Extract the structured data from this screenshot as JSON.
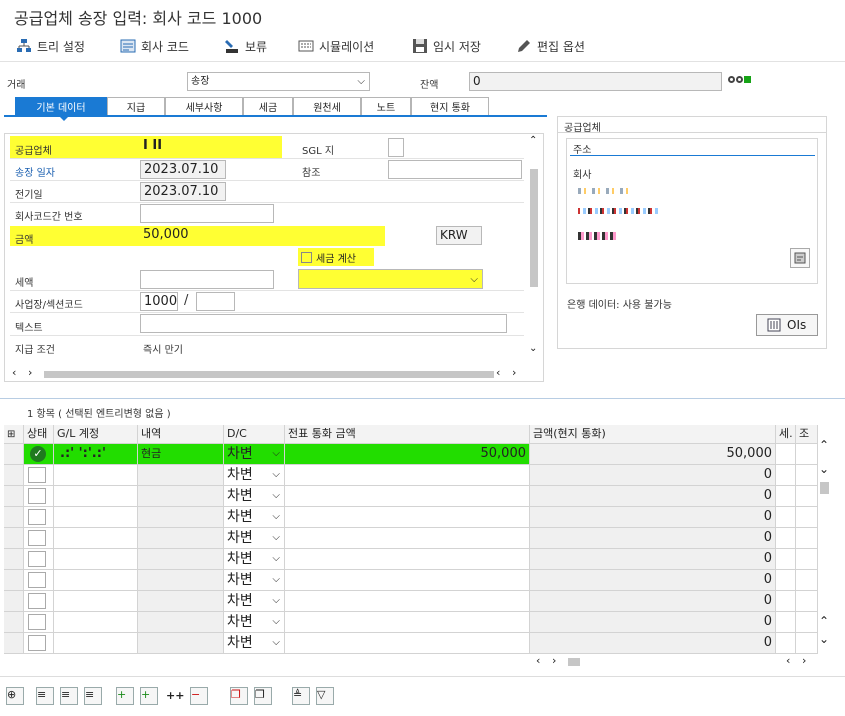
{
  "title": "공급업체 송장 입력: 회사 코드 1000",
  "toolbar": {
    "tree": "트리 설정",
    "company_code": "회사 코드",
    "hold": "보류",
    "simulate": "시뮬레이션",
    "park": "임시 저장",
    "edit_options": "편집 옵션"
  },
  "header": {
    "transaction_label": "거래",
    "transaction_value": "송장",
    "balance_label": "잔액",
    "balance_value": "0"
  },
  "tabs": [
    "기본 데이터",
    "지급",
    "세부사항",
    "세금",
    "원천세",
    "노트",
    "현지 통화"
  ],
  "basic": {
    "vendor_label": "공급업체",
    "vendor_value": "I  II",
    "sgl_label": "SGL 지",
    "invoice_date_label": "송장 일자",
    "invoice_date_value": "2023.07.10",
    "reference_label": "참조",
    "posting_date_label": "전기일",
    "posting_date_value": "2023.07.10",
    "cross_cc_label": "회사코드간 번호",
    "amount_label": "금액",
    "amount_value": "50,000",
    "currency": "KRW",
    "calc_tax_label": "세금 계산",
    "tax_label": "세액",
    "business_place_label": "사업장/섹션코드",
    "business_place_value": "1000",
    "business_place_sep": "/",
    "text_label": "텍스트",
    "payment_terms_label": "지급 조건",
    "payment_terms_value": "즉시 만기"
  },
  "vendor_panel": {
    "title": "공급업체",
    "address_label": "주소",
    "company_label": "회사",
    "bank_data": "은행 데이터: 사용 불가능",
    "ois_button": "OIs"
  },
  "items": {
    "summary": "1 항목 ( 선택된 엔트리변형 없음 )",
    "columns": [
      "상태",
      "G/L 계정",
      "내역",
      "D/C",
      "전표 통화 금액",
      "금액(현지 통화)",
      "세.",
      "조서"
    ],
    "rows": [
      {
        "gl": ".:' ':'.:'",
        "desc": "현금",
        "dc": "차변",
        "doc_amount": "50,000",
        "local_amount": "50,000"
      },
      {
        "dc": "차변",
        "local_amount": "0"
      },
      {
        "dc": "차변",
        "local_amount": "0"
      },
      {
        "dc": "차변",
        "local_amount": "0"
      },
      {
        "dc": "차변",
        "local_amount": "0"
      },
      {
        "dc": "차변",
        "local_amount": "0"
      },
      {
        "dc": "차변",
        "local_amount": "0"
      },
      {
        "dc": "차변",
        "local_amount": "0"
      },
      {
        "dc": "차변",
        "local_amount": "0"
      },
      {
        "dc": "차변",
        "local_amount": "0"
      }
    ]
  },
  "icons": [
    "tree-icon",
    "company-code-icon",
    "hold-icon",
    "simulate-icon",
    "park-icon",
    "edit-options-icon"
  ],
  "colors": {
    "accent": "#1a7ad4",
    "highlight": "#ffff33",
    "row_highlight": "#22dd00"
  }
}
